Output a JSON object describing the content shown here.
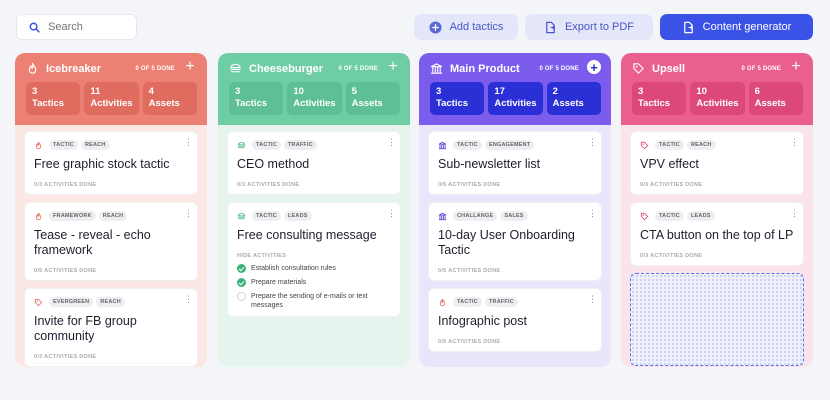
{
  "toolbar": {
    "search_placeholder": "Search",
    "add_tactics": "Add tactics",
    "export_pdf": "Export to PDF",
    "content_generator": "Content generator"
  },
  "colors": {
    "icebreaker": "#ec8074",
    "cheeseburger": "#6fcda4",
    "main_product": "#7b5ced",
    "upsell": "#ea5f8e",
    "accent": "#3b52e6"
  },
  "columns": [
    {
      "title": "Icebreaker",
      "icon": "flame-icon",
      "done": "0 OF 5 DONE",
      "stats": [
        {
          "num": "3",
          "label": "Tactics"
        },
        {
          "num": "11",
          "label": "Activities"
        },
        {
          "num": "4",
          "label": "Assets"
        }
      ],
      "cards": [
        {
          "icon": "flame-icon",
          "tags": [
            "TACTIC",
            "REACH"
          ],
          "title": "Free graphic stock tactic",
          "done": "0/3 ACTIVITIES DONE"
        },
        {
          "icon": "flame-icon",
          "tags": [
            "FRAMEWORK",
            "REACH"
          ],
          "title": "Tease - reveal - echo framework",
          "done": "0/5 ACTIVITIES DONE"
        },
        {
          "icon": "tag-icon",
          "tags": [
            "EVERGREEN",
            "REACH"
          ],
          "title": "Invite for FB group community",
          "done": "0/3 ACTIVITIES DONE"
        }
      ]
    },
    {
      "title": "Cheeseburger",
      "icon": "burger-icon",
      "done": "0 OF 5 DONE",
      "stats": [
        {
          "num": "3",
          "label": "Tactics"
        },
        {
          "num": "10",
          "label": "Activities"
        },
        {
          "num": "5",
          "label": "Assets"
        }
      ],
      "cards": [
        {
          "icon": "burger-icon",
          "tags": [
            "TACTIC",
            "TRAFFIC"
          ],
          "title": "CEO method",
          "done": "0/3 ACTIVITIES DONE"
        },
        {
          "icon": "burger-icon",
          "tags": [
            "TACTIC",
            "LEADS"
          ],
          "title": "Free consulting message",
          "activities_title": "HIDE ACTIVITIES",
          "activities": [
            {
              "text": "Establish consultation rules",
              "done": true
            },
            {
              "text": "Prepare materials",
              "done": true
            },
            {
              "text": "Prepare the sending of e-mails or text messages",
              "done": false
            }
          ]
        }
      ]
    },
    {
      "title": "Main Product",
      "icon": "bank-icon",
      "done": "0 OF 5 DONE",
      "stats": [
        {
          "num": "3",
          "label": "Tactics"
        },
        {
          "num": "17",
          "label": "Activities"
        },
        {
          "num": "2",
          "label": "Assets"
        }
      ],
      "cards": [
        {
          "icon": "bank-icon",
          "tags": [
            "TACTIC",
            "ENGAGEMENT"
          ],
          "title": "Sub-newsletter list",
          "done": "0/5 ACTIVITIES DONE"
        },
        {
          "icon": "bank-icon",
          "tags": [
            "CHALLANGE",
            "SALES"
          ],
          "title": "10-day User Onboarding Tactic",
          "done": "0/5 ACTIVITIES DONE"
        },
        {
          "icon": "flame-icon",
          "tags": [
            "TACTIC",
            "TRAFFIC"
          ],
          "title": "Infographic post",
          "done": "0/5 ACTIVITIES DONE"
        }
      ]
    },
    {
      "title": "Upsell",
      "icon": "tag-icon",
      "done": "0 OF 5 DONE",
      "stats": [
        {
          "num": "3",
          "label": "Tactics"
        },
        {
          "num": "10",
          "label": "Activities"
        },
        {
          "num": "6",
          "label": "Assets"
        }
      ],
      "cards": [
        {
          "icon": "tag-icon",
          "tags": [
            "TACTIC",
            "REACH"
          ],
          "title": "VPV effect",
          "done": "0/3 ACTIVITIES DONE"
        },
        {
          "icon": "tag-icon",
          "tags": [
            "TACTIC",
            "LEADS"
          ],
          "title": "CTA button on the top of LP",
          "done": "0/3 ACTIVITIES DONE"
        }
      ]
    }
  ]
}
